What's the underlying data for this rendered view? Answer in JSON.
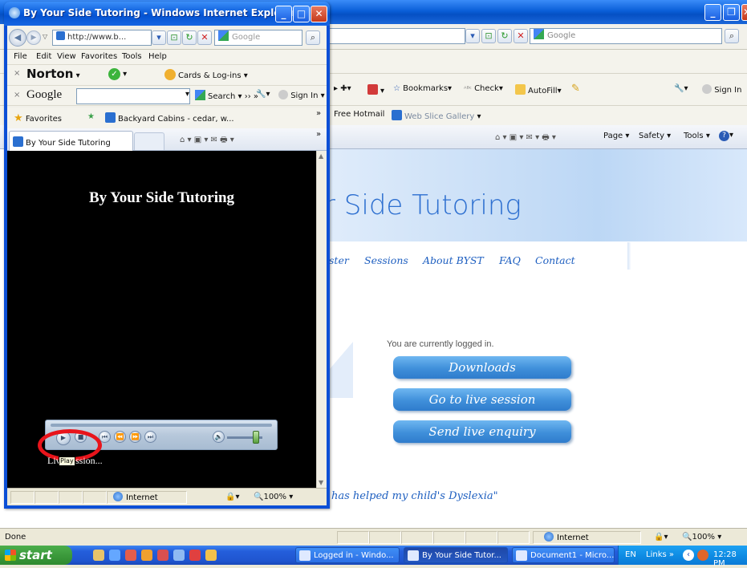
{
  "background_window": {
    "address_bar": {
      "search_placeholder": "Google"
    },
    "toolbar": {
      "bookmarks": "Bookmarks",
      "check": "Check",
      "autofill": "AutoFill",
      "sign_in": "Sign In"
    },
    "favorites_bar": {
      "free_hotmail": "Free Hotmail",
      "web_slice_gallery": "Web Slice Gallery"
    },
    "command_bar": {
      "page": "Page",
      "safety": "Safety",
      "tools": "Tools"
    },
    "site": {
      "title_partial": "r Side Tutoring",
      "nav": [
        "ster",
        "Sessions",
        "About BYST",
        "FAQ",
        "Contact"
      ],
      "logged_in_text": "You are currently logged in.",
      "buttons": [
        "Downloads",
        "Go to live session",
        "Send live enquiry"
      ],
      "quote_partial": "has helped my child's Dyslexia\""
    },
    "status_bar": {
      "status": "Done",
      "zone": "Internet",
      "zoom": "100%"
    }
  },
  "popup_window": {
    "title": "By Your Side Tutoring - Windows Internet Explorer",
    "address": "http://www.b...",
    "search_placeholder": "Google",
    "menu": [
      "File",
      "Edit",
      "View",
      "Favorites",
      "Tools",
      "Help"
    ],
    "norton": {
      "brand": "Norton",
      "cards": "Cards & Log-ins"
    },
    "google_toolbar": {
      "brand": "Google",
      "search": "Search",
      "sign_in": "Sign In"
    },
    "favorites_bar": {
      "favorites": "Favorites",
      "backyard": "Backyard Cabins - cedar, w..."
    },
    "tab": {
      "label": "By Your Side Tutoring"
    },
    "content": {
      "heading": "By Your Side Tutoring",
      "status_text": "Live session...",
      "tooltip": "Play"
    },
    "status_bar": {
      "zone": "Internet",
      "zoom": "100%"
    }
  },
  "taskbar": {
    "start": "start",
    "tasks": [
      "Logged in - Windo...",
      "By Your Side Tutor...",
      "Document1 - Micro..."
    ],
    "tray": {
      "language": "EN",
      "links": "Links",
      "clock": "12:28 PM"
    }
  },
  "colors": {
    "xp_blue": "#0a5fd8",
    "site_blue": "#1e5fc0",
    "button_blue": "#3f8fda",
    "highlight_red": "#e8141b",
    "start_green": "#3c9a3c"
  }
}
